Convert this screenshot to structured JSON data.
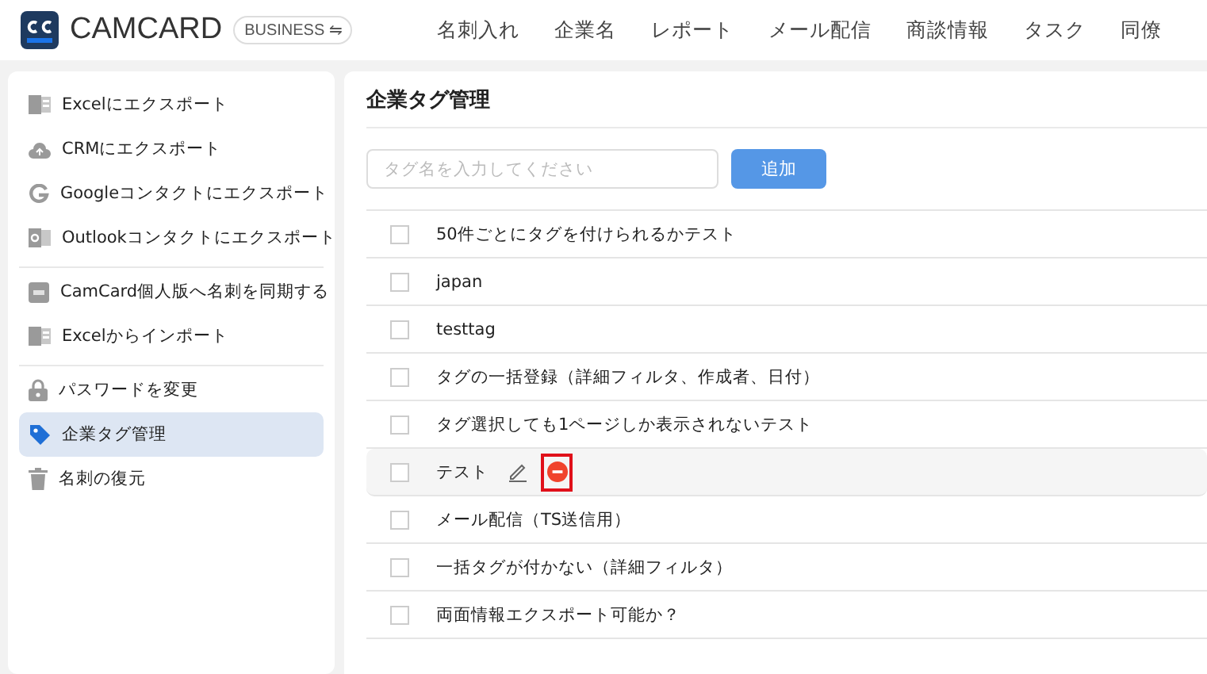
{
  "header": {
    "logo_text": "CAMCARD",
    "edition": "BUSINESS ⇋",
    "nav": [
      "名刺入れ",
      "企業名",
      "レポート",
      "メール配信",
      "商談情報",
      "タスク",
      "同僚"
    ]
  },
  "sidebar": {
    "groups": [
      {
        "items": [
          {
            "kind": "excel",
            "label": "Excelにエクスポート",
            "selected": false
          },
          {
            "kind": "cloud",
            "label": "CRMにエクスポート",
            "selected": false
          },
          {
            "kind": "google",
            "label": "Googleコンタクトにエクスポート",
            "selected": false
          },
          {
            "kind": "outlook",
            "label": "Outlookコンタクトにエクスポート",
            "selected": false
          }
        ]
      },
      {
        "items": [
          {
            "kind": "camcard",
            "label": "CamCard個人版へ名刺を同期する",
            "selected": false
          },
          {
            "kind": "excel",
            "label": "Excelからインポート",
            "selected": false
          }
        ]
      },
      {
        "items": [
          {
            "kind": "lock",
            "label": "パスワードを変更",
            "selected": false
          },
          {
            "kind": "tag",
            "label": "企業タグ管理",
            "selected": true
          },
          {
            "kind": "trash",
            "label": "名刺の復元",
            "selected": false
          }
        ]
      }
    ]
  },
  "main": {
    "title": "企業タグ管理",
    "tag_input": {
      "placeholder": "タグ名を入力してください"
    },
    "add_button": "追加",
    "tags": [
      {
        "label": "50件ごとにタグを付けられるかテスト",
        "checked": false,
        "hovered": false
      },
      {
        "label": "japan",
        "checked": false,
        "hovered": false
      },
      {
        "label": "testtag",
        "checked": false,
        "hovered": false
      },
      {
        "label": "タグの一括登録（詳細フィルタ、作成者、日付）",
        "checked": false,
        "hovered": false
      },
      {
        "label": "タグ選択しても1ページしか表示されないテスト",
        "checked": false,
        "hovered": false
      },
      {
        "label": "テスト",
        "checked": false,
        "hovered": true
      },
      {
        "label": "メール配信（TS送信用）",
        "checked": false,
        "hovered": false
      },
      {
        "label": "一括タグが付かない（詳細フィルタ）",
        "checked": false,
        "hovered": false
      },
      {
        "label": "両面情報エクスポート可能か？",
        "checked": false,
        "hovered": false
      }
    ]
  }
}
